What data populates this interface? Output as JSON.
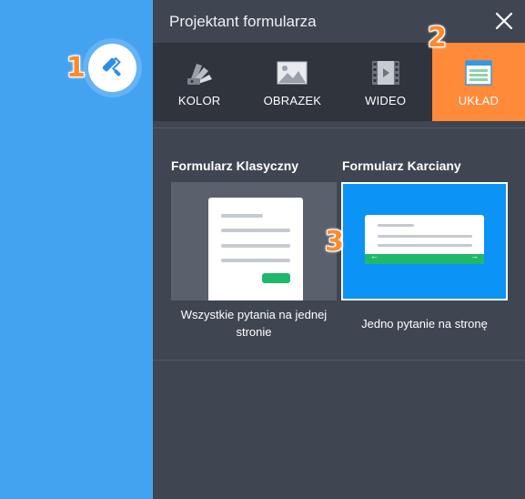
{
  "panel": {
    "title": "Projektant formularza"
  },
  "tabs": [
    {
      "label": "KOLOR",
      "icon": "color-swatch-icon",
      "active": false
    },
    {
      "label": "OBRAZEK",
      "icon": "image-icon",
      "active": false
    },
    {
      "label": "WIDEO",
      "icon": "video-film-icon",
      "active": false
    },
    {
      "label": "UKŁAD",
      "icon": "layout-icon",
      "active": true
    }
  ],
  "layouts": {
    "classic": {
      "title": "Formularz Klasyczny",
      "description": "Wszystkie pytania na jednej stronie"
    },
    "card": {
      "title": "Formularz Karciany",
      "description": "Jedno pytanie na stronę",
      "selected": true
    }
  },
  "markers": [
    "1",
    "2",
    "3"
  ],
  "colors": {
    "left_background": "#44a3f1",
    "panel_background": "#3f4551",
    "tab_bar": "#2f343d",
    "active_tab": "#ff8a3a",
    "selected_card": "#0b93f6",
    "accent_green": "#1fb86b",
    "marker": "#ff8a2b"
  }
}
